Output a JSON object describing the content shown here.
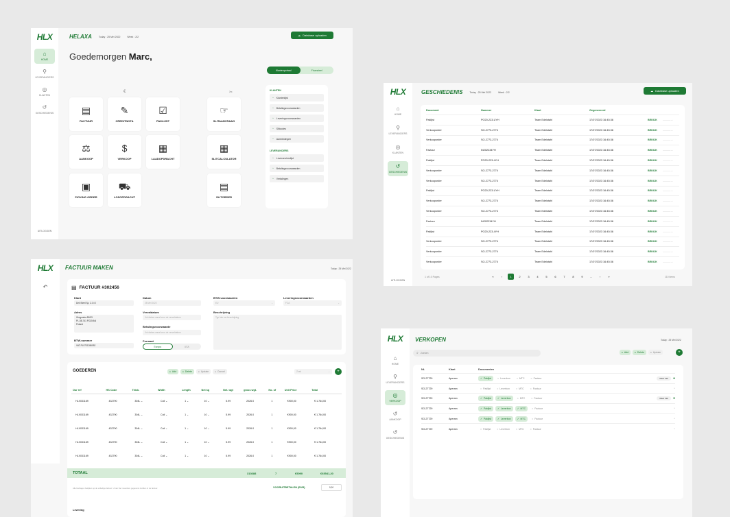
{
  "home": {
    "logo": "HLX",
    "brand": "HELAXA",
    "today": "Today : 25 Mei 2022",
    "week": "Week : 2/2",
    "upload": "Database uploaden",
    "greeting_pre": "Goedemorgen ",
    "greeting_name": "Marc,",
    "toggle": [
      "Klantenportaal",
      "Financieel"
    ],
    "nav": [
      {
        "label": "Home",
        "icon": "⌂"
      },
      {
        "label": "Leveranciers",
        "icon": "⚲"
      },
      {
        "label": "Klanten",
        "icon": "◎"
      },
      {
        "label": "Geschiedenis",
        "icon": "↺"
      }
    ],
    "logout": "Uitloggen",
    "tiles": [
      {
        "label": "Factuur",
        "icon": "▤"
      },
      {
        "label": "Creditnota",
        "icon": "✎"
      },
      {
        "label": "Paklijst",
        "icon": "☑"
      },
      {
        "label": "Aankoop",
        "icon": "⚖"
      },
      {
        "label": "Verkoop",
        "icon": "$"
      },
      {
        "label": "Laadopdracht",
        "icon": "▦"
      },
      {
        "label": "Picking order",
        "icon": "▣"
      },
      {
        "label": "Losopdracht",
        "icon": "⛟"
      },
      {
        "label": "Slitaanvraag",
        "icon": "☞"
      },
      {
        "label": "Slitcalculator",
        "icon": "▦"
      },
      {
        "label": "Slitorder",
        "icon": "▤"
      }
    ],
    "klanten_head": "Klanten",
    "klanten": [
      "Klantenlijst",
      "Betalingsvoorwaarden",
      "Leveringsvoorwaarden",
      "Slitcodes",
      "Aanbiedingen"
    ],
    "lev_head": "Leveranciers",
    "leveranciers": [
      "Leverancierslijst",
      "Betalingsvoorwaarden",
      "Vertalingen"
    ]
  },
  "hist": {
    "logo": "HLX",
    "title": "Geschiedenis",
    "today": "Today : 25 Mei 2022",
    "week": "Week : 2/2",
    "upload": "Database uploaden",
    "nav": [
      {
        "label": "Home",
        "icon": "⌂"
      },
      {
        "label": "Leveranciers",
        "icon": "⚲"
      },
      {
        "label": "Klanten",
        "icon": "◎"
      },
      {
        "label": "Geschiedenis",
        "icon": "↺"
      }
    ],
    "logout": "Uitloggen",
    "headers": [
      "Document",
      "Nummer",
      "Klant",
      "Gegenereerd"
    ],
    "action": "BEKIJK",
    "rows": [
      [
        "Paklijst",
        "PO20-223-UYH",
        "Team Edelstahl",
        "17/07/2023 16:45:36"
      ],
      [
        "Verkooporder",
        "SO-2773-2774",
        "Team Edelstahl",
        "17/07/2023 16:45:36"
      ],
      [
        "Verkooporder",
        "SO-2773-2774",
        "Team Edelstahl",
        "17/07/2023 16:45:36"
      ],
      [
        "Factuur",
        "IN202234YH",
        "Team Edelstahl",
        "17/07/2023 16:45:36"
      ],
      [
        "Paklijst",
        "PO20-223-4YH",
        "Team Edelstahl",
        "17/07/2023 16:45:36"
      ],
      [
        "Verkooporder",
        "SO-2773-2774",
        "Team Edelstahl",
        "17/07/2023 16:45:36"
      ],
      [
        "Verkooporder",
        "SO-2773-2774",
        "Team Edelstahl",
        "17/07/2023 16:45:36"
      ],
      [
        "Paklijst",
        "PO20-223-UYH",
        "Team Edelstahl",
        "17/07/2023 16:45:36"
      ],
      [
        "Verkooporder",
        "SO-2773-2774",
        "Team Edelstahl",
        "17/07/2023 16:45:36"
      ],
      [
        "Verkooporder",
        "SO-2773-2774",
        "Team Edelstahl",
        "17/07/2023 16:45:36"
      ],
      [
        "Factuur",
        "IN202234YH",
        "Team Edelstahl",
        "17/07/2023 16:45:36"
      ],
      [
        "Paklijst",
        "PO20-223-4YH",
        "Team Edelstahl",
        "17/07/2023 16:45:36"
      ],
      [
        "Verkooporder",
        "SO-2773-2774",
        "Team Edelstahl",
        "17/07/2023 16:45:36"
      ],
      [
        "Verkooporder",
        "SO-2773-2774",
        "Team Edelstahl",
        "17/07/2023 16:45:36"
      ],
      [
        "Verkooporder",
        "SO-2773-2774",
        "Team Edelstahl",
        "17/07/2023 16:45:36"
      ]
    ],
    "pages": [
      "«",
      "‹",
      "1",
      "2",
      "3",
      "4",
      "5",
      "6",
      "7",
      "8",
      "9",
      "...",
      "›",
      "»"
    ],
    "page_info": "1 of 10 Pages",
    "items": "110 items"
  },
  "fact": {
    "logo": "HLX",
    "title": "Factuur maken",
    "today": "Today : 25 Mei 2022",
    "invoice": "FACTUUR #302456",
    "klant_l": "Klant",
    "klant_v": "Deli Steel Sp. Z.O.O",
    "adres_l": "Adres",
    "adres_v": [
      "Gregorska 50/53",
      "PL-58-741 POZNAN",
      "Poland"
    ],
    "btw_l": "BTW-nummer",
    "btw_v": "VAT-PL9731286052",
    "datum_l": "Datum",
    "datum_v": "25 Mei 2022",
    "verval_l": "Vervaldatum",
    "verval_v": "Vul datum vanaf voor de vervaldatum",
    "betal_l": "Betalingsvoorwaarde",
    "betal_v": "Vul datum vanaf voor de vervaldatum",
    "format_l": "Formaat",
    "formats": [
      "Europa",
      "USA"
    ],
    "btwv_l": "BTW-voorwaarden",
    "btwv_v": "EU",
    "lev_l": "Leveringsvoorwaarden",
    "lev_v": "FCA",
    "beschr_l": "Beschrijving",
    "beschr_v": "Typ hier uw beschrijving",
    "goederen": "GOEDEREN",
    "actions": [
      "Add",
      "Delete",
      "Update",
      "Cancel"
    ],
    "search": "Zoek",
    "cols": [
      "Our ref",
      "HS Code",
      "Thick.",
      "Width",
      "Length",
      "Net kg",
      "Net. wgt",
      "gross wgt.",
      "No. of",
      "Unit Price",
      "Total"
    ],
    "rows": [
      [
        "HLX031169",
        "432790",
        "304L",
        "Coil",
        "1",
        "10",
        "5.99",
        "2026.0",
        "1",
        "€900,00",
        "€ 1.764,00"
      ],
      [
        "HLX031169",
        "432790",
        "304L",
        "Coil",
        "1",
        "10",
        "5.99",
        "2026.0",
        "1",
        "€900,00",
        "€ 1.764,00"
      ],
      [
        "HLX031169",
        "432790",
        "304L",
        "Coil",
        "1",
        "10",
        "5.99",
        "2026.0",
        "1",
        "€900,00",
        "€ 1.764,00"
      ],
      [
        "HLX031169",
        "432790",
        "304L",
        "Coil",
        "1",
        "10",
        "5.99",
        "2026.0",
        "1",
        "€900,00",
        "€ 1.764,00"
      ],
      [
        "HLX031169",
        "432790",
        "304L",
        "Coil",
        "1",
        "10",
        "5.99",
        "2026.0",
        "1",
        "€900,00",
        "€ 1.764,00"
      ]
    ],
    "totaal": "TOTAAL",
    "tot_vals": [
      "313688",
      "7",
      "€5090",
      "€65541,20"
    ],
    "note": "Alle bedragen bekijken op de volledige factuur. U kan hier meerdere gegevens invullen in de factuur.",
    "voor_l": "VOORUITBETALEN (EUR)",
    "voor_v": "0,00",
    "levering": "Levering"
  },
  "verk": {
    "logo": "HLX",
    "title": "Verkopen",
    "today": "Today : 25 Mei 2022",
    "search": "Zoeken",
    "actions": [
      "Add",
      "Delete",
      "Update"
    ],
    "nav": [
      {
        "label": "Home",
        "icon": "⌂"
      },
      {
        "label": "Leveranciers",
        "icon": "⚲"
      },
      {
        "label": "Verkoop",
        "icon": "◎"
      },
      {
        "label": "Aankoop",
        "icon": "↺"
      },
      {
        "label": "Geschiedenis",
        "icon": "↺"
      }
    ],
    "headers": [
      "NL",
      "Klant",
      "Documenten"
    ],
    "docs": [
      "Paklijst",
      "Leverbon",
      "MTC",
      "Factuur"
    ],
    "more": "Meer info",
    "rows": [
      {
        "nl": "SO-27729",
        "klant": "Aperam",
        "st": [
          1,
          0,
          0,
          0
        ],
        "more": true
      },
      {
        "nl": "SO-27729",
        "klant": "Aperam",
        "st": [
          0,
          0,
          0,
          0
        ],
        "more": false
      },
      {
        "nl": "SO-27729",
        "klant": "Aperam",
        "st": [
          1,
          1,
          0,
          0
        ],
        "more": true
      },
      {
        "nl": "SO-27729",
        "klant": "Aperam",
        "st": [
          1,
          1,
          1,
          0
        ],
        "more": false
      },
      {
        "nl": "SO-27729",
        "klant": "Aperam",
        "st": [
          1,
          1,
          1,
          0
        ],
        "more": false
      },
      {
        "nl": "SO-27729",
        "klant": "Aperam",
        "st": [
          0,
          0,
          0,
          0
        ],
        "more": false
      }
    ]
  },
  "colors": {
    "accent": "#1e7a34",
    "accent_light": "#d6ecd8"
  }
}
